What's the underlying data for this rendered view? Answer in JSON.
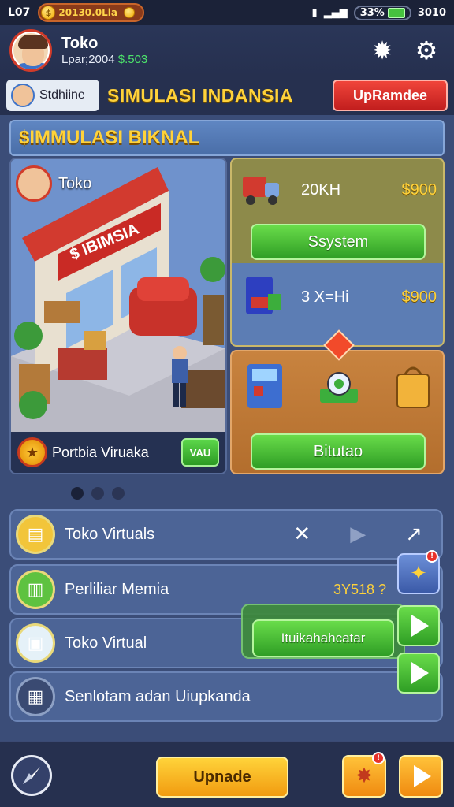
{
  "status_bar": {
    "left_text": "L07",
    "coin_text": "20130.0Lla",
    "coin_symbol": "$",
    "right_text": "33%",
    "signal": "3010"
  },
  "header": {
    "player_name": "Toko",
    "money_prefix": "Lpar;2004",
    "money_value": "$.503"
  },
  "title_bar": {
    "tab_label": "Stdhiine",
    "game_title": "SIMULASI INDANSIA",
    "upgrade_label": "UpRamdee"
  },
  "banner": {
    "title": "$IMMULASI BIKNAL"
  },
  "scene_card": {
    "store_name": "Toko",
    "shop_sign": "$ IBIMSIA",
    "footer_label": "Portbia Viruaka",
    "footer_btn": "VAU"
  },
  "card_a": {
    "rows": [
      {
        "label": "20KH",
        "price": "$900"
      },
      {
        "label": "3 X=Hi",
        "price": "$900"
      }
    ],
    "button": "Ssystem"
  },
  "card_b": {
    "button": "Bitutao"
  },
  "list": [
    {
      "label": "Toko Virtuals",
      "color": "#f2c53a"
    },
    {
      "label": "Perliliar Memia",
      "value": "3Y518 ?",
      "color": "#5ec240"
    },
    {
      "label": "Toko Virtual",
      "color": "#e5f1f8"
    },
    {
      "label": "Senlotam adan Uiupkanda",
      "color": "#3a4a72"
    }
  ],
  "hint_button": "Ituikahahcatar",
  "bottom_bar": {
    "main_button": "Upnade",
    "badge": "!"
  },
  "colors": {
    "accent_yellow": "#ffd23a",
    "accent_green": "#2f9e25",
    "accent_red": "#c21e1e",
    "background": "#3b4d78"
  },
  "icons": [
    "settings-gear-icon",
    "cog-icon",
    "close-icon",
    "play-arrow-icon",
    "compass-icon",
    "pin-icon",
    "bell-icon"
  ]
}
